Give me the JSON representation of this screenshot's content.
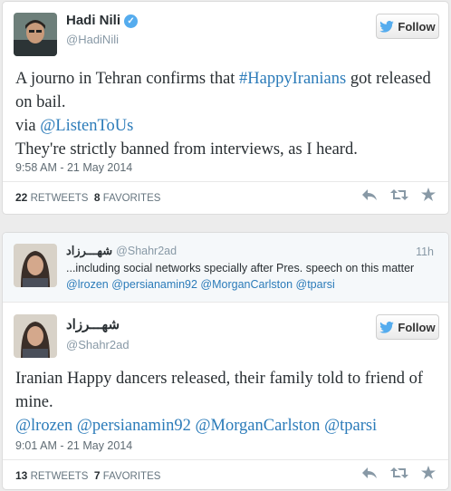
{
  "colors": {
    "link": "#2b7bb9",
    "verified": "#55acee",
    "text": "#292f33",
    "muted": "#8899a6"
  },
  "tweet1": {
    "name": "Hadi Nili",
    "handle": "@HadiNili",
    "follow_label": "Follow",
    "text_parts": [
      "A journo in Tehran confirms that ",
      "#HappyIranians",
      " got released on bail.",
      "via ",
      "@ListenToUs",
      "They're strictly banned from interviews, as I heard."
    ],
    "timestamp": "9:58 AM - 21 May 2014",
    "retweets_count": "22",
    "retweets_label": "RETWEETS",
    "favorites_count": "8",
    "favorites_label": "FAVORITES",
    "icons": [
      "avatar",
      "verified-badge-icon",
      "twitter-bird-icon",
      "reply-icon",
      "retweet-icon",
      "favorite-star-icon"
    ]
  },
  "parent_tweet": {
    "name": "شهـــرزاد",
    "handle": "@Shahr2ad",
    "time": "11h",
    "text": "...including social networks specially after Pres. speech on this matter",
    "mentions": [
      "@lrozen",
      "@persianamin92",
      "@MorganCarlston",
      "@tparsi"
    ]
  },
  "tweet2": {
    "name": "شهـــرزاد",
    "handle": "@Shahr2ad",
    "follow_label": "Follow",
    "text_line": "Iranian Happy dancers released, their family told to friend of mine.",
    "mentions": [
      "@lrozen",
      "@persianamin92",
      "@MorganCarlston",
      "@tparsi"
    ],
    "timestamp": "9:01 AM - 21 May 2014",
    "retweets_count": "13",
    "retweets_label": "RETWEETS",
    "favorites_count": "7",
    "favorites_label": "FAVORITES"
  }
}
